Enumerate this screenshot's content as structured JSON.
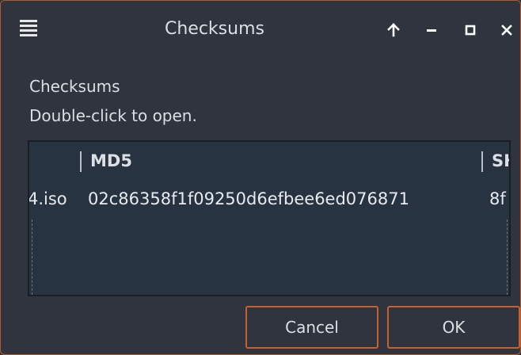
{
  "window": {
    "title": "Checksums",
    "controls": {
      "keep_above": "↑",
      "minimize": "–",
      "maximize": "▢",
      "close": "✕"
    }
  },
  "dialog": {
    "heading": "Checksums",
    "hint": "Double-click to open."
  },
  "table": {
    "columns": [
      "",
      "MD5",
      "SH"
    ],
    "rows": [
      {
        "name": "4.iso",
        "md5": "02c86358f1f09250d6efbee6ed076871",
        "sha": "8f"
      }
    ]
  },
  "buttons": {
    "cancel": "Cancel",
    "ok": "OK"
  },
  "colors": {
    "background": "#2f343f",
    "accent_border": "#c4612f",
    "table_background": "#283341",
    "text": "#dcdfe4"
  },
  "icons": {
    "window_menu": "hamburger-menu-icon",
    "keep_above": "arrow-up-icon",
    "minimize": "minimize-icon",
    "maximize": "maximize-icon",
    "close": "close-icon"
  }
}
